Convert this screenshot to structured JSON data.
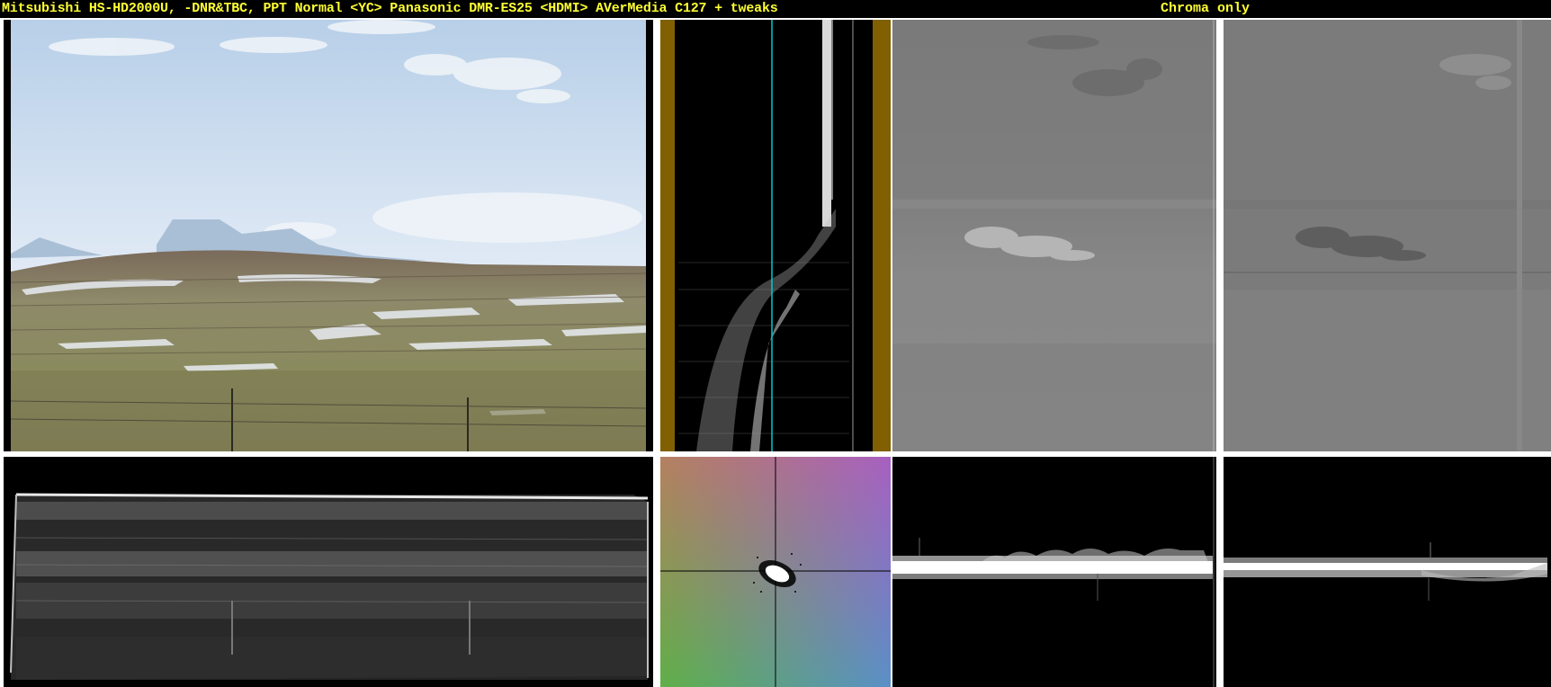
{
  "header": {
    "title": "Mitsubishi HS-HD2000U, -DNR&TBC, PPT Normal <YC> Panasonic DMR-ES25 <HDMI> AVerMedia C127 + tweaks",
    "mode_label": "Chroma only"
  },
  "panels": {
    "video_frame": "video-frame",
    "vertical_waveform": "vertical-waveform",
    "chroma_u": "chroma-u-plane",
    "chroma_v": "chroma-v-plane",
    "luma_waveform": "luma-waveform",
    "vectorscope": "vectorscope",
    "u_waveform": "u-waveform",
    "v_waveform": "v-waveform"
  },
  "colors": {
    "title_text": "#ffff33",
    "background": "#000000",
    "divider": "#ffffff",
    "vectorscope_trace": "#00cccc",
    "vertical_waveform_border": "#806000"
  }
}
